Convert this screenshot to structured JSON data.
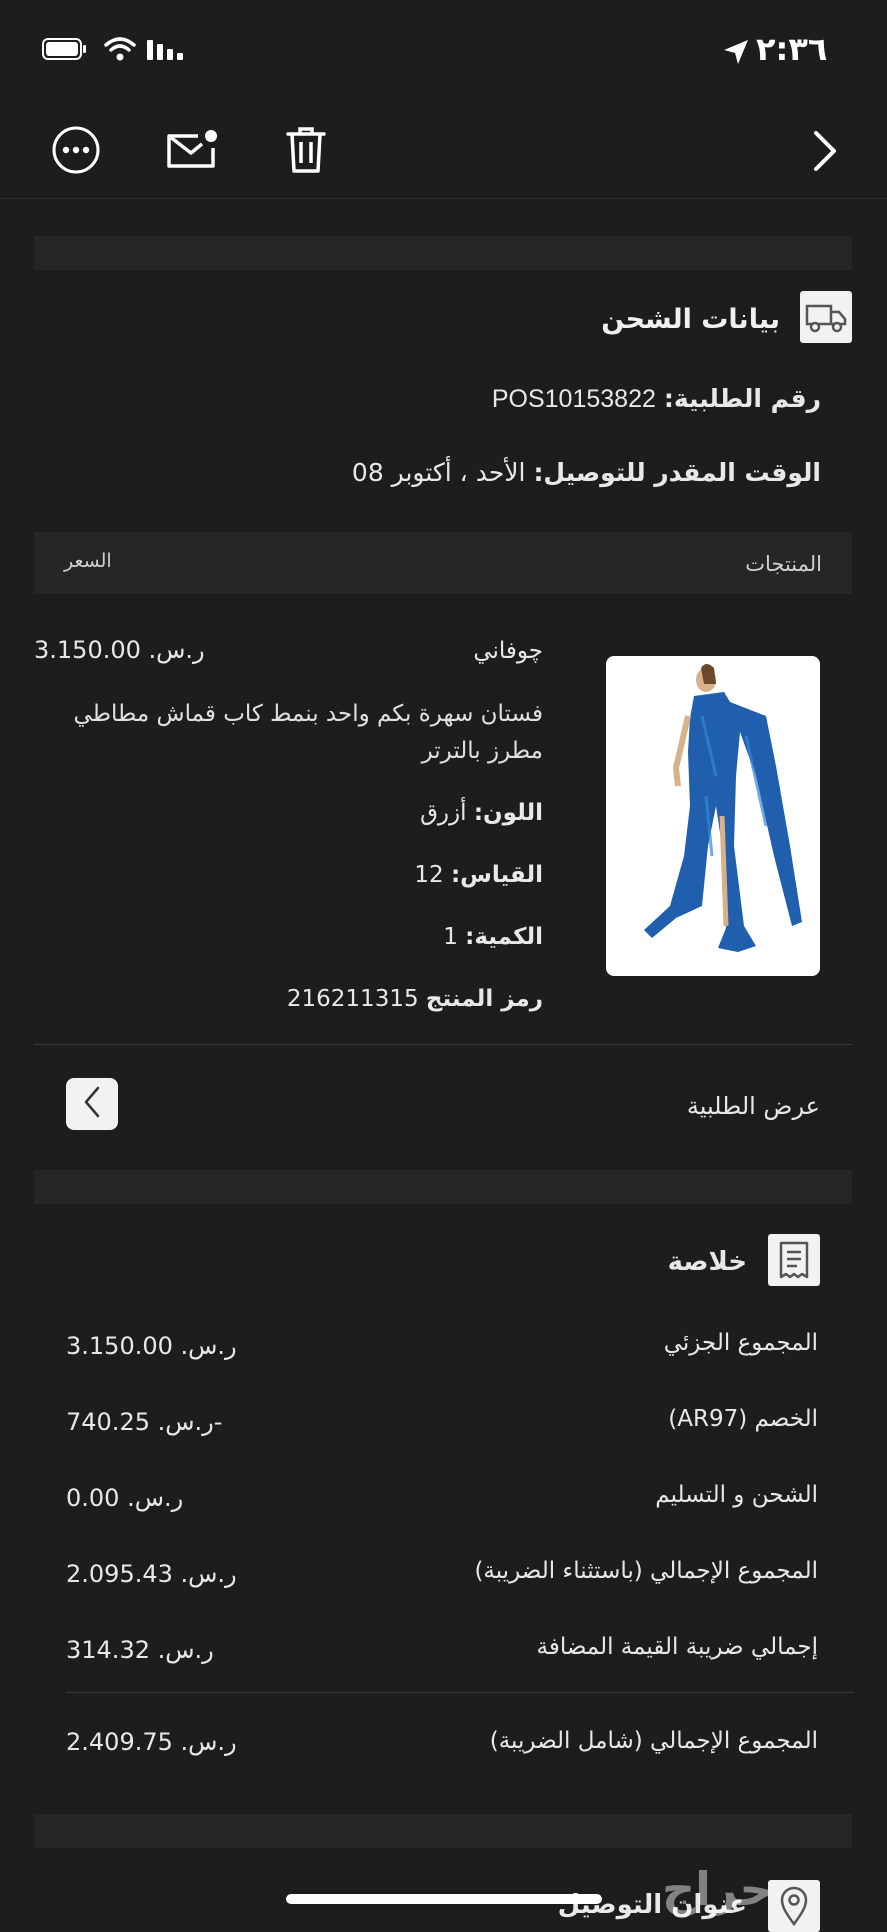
{
  "status_bar": {
    "time": "٢:٣٦"
  },
  "shipping": {
    "title": "بيانات الشحن",
    "order_number_label": "رقم الطلبية:",
    "order_number": "POS10153822",
    "eta_label": "الوقت المقدر للتوصيل:",
    "eta_value": "الأحد ، أكتوبر 08"
  },
  "products_header": {
    "products": "المنتجات",
    "price": "السعر"
  },
  "product": {
    "brand": "چوفاني",
    "price": "ر.س. 3.150.00",
    "name": "فستان سهرة بكم واحد بنمط كاب قماش مطاطي مطرز بالترتر",
    "color_label": "اللون:",
    "color_value": "أزرق",
    "size_label": "القياس:",
    "size_value": "12",
    "qty_label": "الكمية:",
    "qty_value": "1",
    "code_label": "رمز المنتج",
    "code_value": "216211315"
  },
  "view_order": {
    "label": "عرض الطلبية"
  },
  "summary": {
    "title": "خلاصة",
    "rows": [
      {
        "label": "المجموع الجزئي",
        "value": "ر.س. 3.150.00"
      },
      {
        "label": "الخصم (AR97)",
        "value": "-ر.س. 740.25"
      },
      {
        "label": "الشحن و التسليم",
        "value": "ر.س. 0.00"
      },
      {
        "label": "المجموع الإجمالي (باستثناء الضريبة)",
        "value": "ر.س. 2.095.43"
      },
      {
        "label": "إجمالي ضريبة القيمة المضافة",
        "value": "ر.س. 314.32"
      }
    ],
    "total": {
      "label": "المجموع الإجمالي (شامل الضريبة)",
      "value": "ر.س. 2.409.75"
    }
  },
  "address": {
    "title": "عنوان التوصيل"
  },
  "watermark": "حراج",
  "icons": [
    "back-chevron-icon",
    "more-icon",
    "mail-icon",
    "trash-icon",
    "truck-icon",
    "receipt-icon",
    "chevron-left-icon",
    "location-pin-icon",
    "battery-icon",
    "wifi-icon",
    "signal-icon",
    "location-arrow-icon"
  ],
  "colors": {
    "background": "#1d1d1f",
    "band": "#262629",
    "text": "#e8e8e8",
    "muted": "#bdbdbd",
    "dress_blue": "#1f5fae"
  }
}
